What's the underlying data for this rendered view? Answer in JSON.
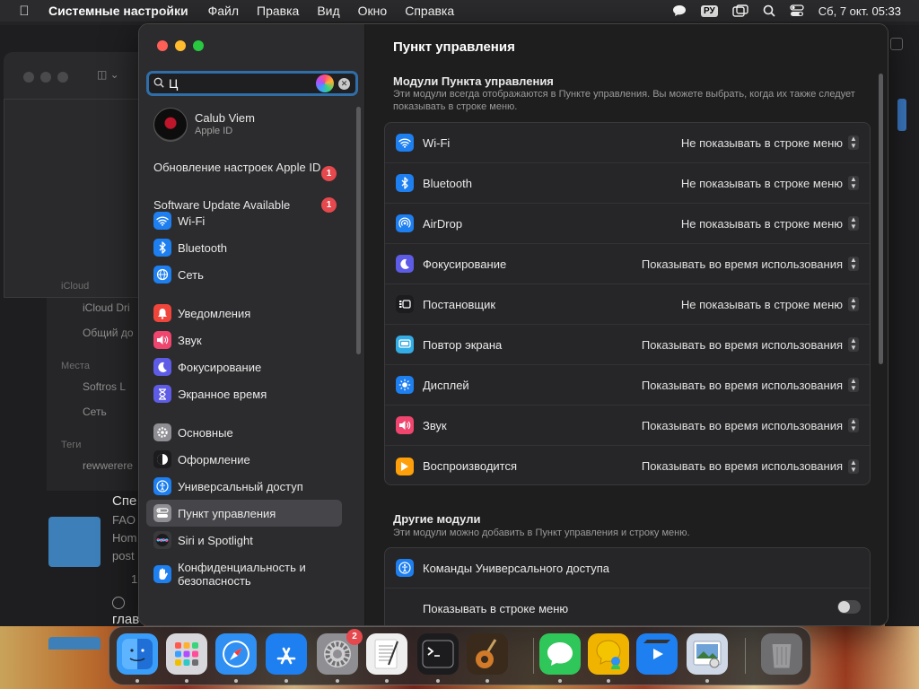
{
  "menubar": {
    "app_name": "Системные настройки",
    "menus": [
      "Файл",
      "Правка",
      "Вид",
      "Окно",
      "Справка"
    ],
    "input_lang": "РУ",
    "datetime": "Сб, 7 окт.  05:33"
  },
  "background_window": {
    "icloud_header": "iCloud",
    "icloud_drive": "iCloud Dri",
    "shared": "Общий до",
    "places_header": "Места",
    "softros": "Softros L",
    "network": "Сеть",
    "tags_header": "Теги",
    "tag_cut": "rewwerere",
    "item1_title": "Спе",
    "item1_sub1": "FAO",
    "item1_sub2": "Hom",
    "item1_sub3": "post",
    "item1_time": "1",
    "item2_title": "глав"
  },
  "search": {
    "value": "Ц"
  },
  "account": {
    "name": "Calub Viem",
    "subtitle": "Apple ID"
  },
  "notices": [
    {
      "label": "Обновление настроек Apple ID",
      "badge": "1"
    },
    {
      "label": "Software Update Available",
      "badge": "1"
    }
  ],
  "sidebar": {
    "items": [
      {
        "label": "Wi-Fi",
        "icon": "wifi-icon",
        "color": "#1e7ff0"
      },
      {
        "label": "Bluetooth",
        "icon": "bluetooth-icon",
        "color": "#1e7ff0"
      },
      {
        "label": "Сеть",
        "icon": "globe-icon",
        "color": "#1e7ff0"
      },
      {
        "label": "Уведомления",
        "icon": "bell-icon",
        "color": "#f0453a"
      },
      {
        "label": "Звук",
        "icon": "speaker-icon",
        "color": "#f0456e"
      },
      {
        "label": "Фокусирование",
        "icon": "moon-icon",
        "color": "#5e5ce6"
      },
      {
        "label": "Экранное время",
        "icon": "hourglass-icon",
        "color": "#5e5ce6"
      },
      {
        "label": "Основные",
        "icon": "gear-icon",
        "color": "#8e8e93"
      },
      {
        "label": "Оформление",
        "icon": "appearance-icon",
        "color": "#1c1c1e"
      },
      {
        "label": "Универсальный доступ",
        "icon": "accessibility-icon",
        "color": "#1e7ff0"
      },
      {
        "label": "Пункт управления",
        "icon": "control-center-icon",
        "color": "#8e8e93"
      },
      {
        "label": "Siri и Spotlight",
        "icon": "siri-icon",
        "color": "#3a3a3c"
      },
      {
        "label": "Конфиденциальность и безопасность",
        "icon": "hand-icon",
        "color": "#1e7ff0"
      }
    ]
  },
  "content": {
    "title": "Пункт управления",
    "modules_title": "Модули Пункта управления",
    "modules_desc": "Эти модули всегда отображаются в Пункте управления. Вы можете выбрать, когда их также следует показывать в строке меню.",
    "modules": [
      {
        "label": "Wi-Fi",
        "value": "Не показывать в строке меню",
        "icon": "wifi-icon",
        "color": "#1e7ff0"
      },
      {
        "label": "Bluetooth",
        "value": "Не показывать в строке меню",
        "icon": "bluetooth-icon",
        "color": "#1e7ff0"
      },
      {
        "label": "AirDrop",
        "value": "Не показывать в строке меню",
        "icon": "airdrop-icon",
        "color": "#1e7ff0"
      },
      {
        "label": "Фокусирование",
        "value": "Показывать во время использования",
        "icon": "moon-icon",
        "color": "#5e5ce6"
      },
      {
        "label": "Постановщик",
        "value": "Не показывать в строке меню",
        "icon": "stage-manager-icon",
        "color": "#1c1c1e"
      },
      {
        "label": "Повтор экрана",
        "value": "Показывать во время использования",
        "icon": "screen-mirroring-icon",
        "color": "#32ade6"
      },
      {
        "label": "Дисплей",
        "value": "Показывать во время использования",
        "icon": "sun-icon",
        "color": "#1e7ff0"
      },
      {
        "label": "Звук",
        "value": "Показывать во время использования",
        "icon": "speaker-icon",
        "color": "#f0456e"
      },
      {
        "label": "Воспроизводится",
        "value": "Показывать во время использования",
        "icon": "play-icon",
        "color": "#ff9f0a"
      }
    ],
    "other_title": "Другие модули",
    "other_desc": "Эти модули можно добавить в Пункт управления и строку меню.",
    "other_modules": [
      {
        "label": "Команды Универсального доступа",
        "icon": "accessibility-icon",
        "color": "#1e7ff0"
      }
    ],
    "show_in_menubar_label": "Показывать в строке меню"
  },
  "dock": {
    "apps": [
      {
        "name": "finder-icon",
        "color": "#3a9df7"
      },
      {
        "name": "launchpad-icon",
        "color": "#d8d8dc"
      },
      {
        "name": "safari-icon",
        "color": "#2f8ff3"
      },
      {
        "name": "app-store-icon",
        "color": "#1e7ff0"
      },
      {
        "name": "system-settings-icon",
        "color": "#8e8e93",
        "badge": "2"
      },
      {
        "name": "textedit-icon",
        "color": "#efefef"
      },
      {
        "name": "terminal-icon",
        "color": "#1c1c1e"
      },
      {
        "name": "garageband-icon",
        "color": "#3a2a1c"
      },
      {
        "name": "messages-icon",
        "color": "#30c75a"
      },
      {
        "name": "sketch-person-icon",
        "color": "#f0b400"
      },
      {
        "name": "imovie-icon",
        "color": "#1e7ff0"
      },
      {
        "name": "preview-icon",
        "color": "#cfd8e6"
      },
      {
        "name": "trash-icon",
        "color": "#6e6e70"
      }
    ]
  }
}
